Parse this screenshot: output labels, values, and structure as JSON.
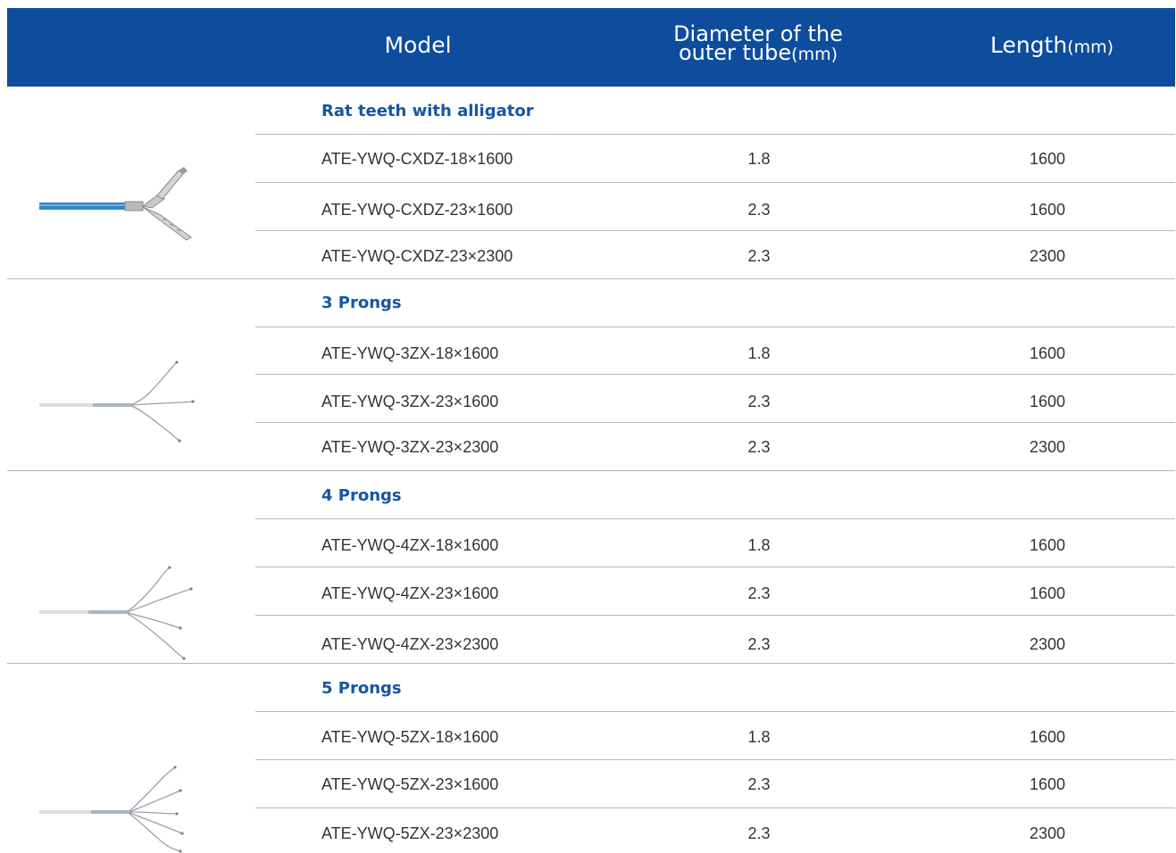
{
  "header": {
    "model": "Model",
    "diameter_line1": "Diameter of the",
    "diameter_line2": "outer tube",
    "diameter_unit": "(mm)",
    "length": "Length",
    "length_unit": "(mm)"
  },
  "colors": {
    "header_bg": "#0e4c9e",
    "group_title": "#1556a5",
    "tube_blue": "#2b86c9"
  },
  "groups": [
    {
      "title": "Rat teeth with alligator",
      "icon": "rat-tooth-alligator-forceps-icon",
      "rows": [
        {
          "model": "ATE-YWQ-CXDZ-18×1600",
          "diameter": "1.8",
          "length": "1600"
        },
        {
          "model": "ATE-YWQ-CXDZ-23×1600",
          "diameter": "2.3",
          "length": "1600"
        },
        {
          "model": "ATE-YWQ-CXDZ-23×2300",
          "diameter": "2.3",
          "length": "2300"
        }
      ]
    },
    {
      "title": "3 Prongs",
      "icon": "three-prong-grasper-icon",
      "rows": [
        {
          "model": "ATE-YWQ-3ZX-18×1600",
          "diameter": "1.8",
          "length": "1600"
        },
        {
          "model": "ATE-YWQ-3ZX-23×1600",
          "diameter": "2.3",
          "length": "1600"
        },
        {
          "model": "ATE-YWQ-3ZX-23×2300",
          "diameter": "2.3",
          "length": "2300"
        }
      ]
    },
    {
      "title": "4 Prongs",
      "icon": "four-prong-grasper-icon",
      "rows": [
        {
          "model": "ATE-YWQ-4ZX-18×1600",
          "diameter": "1.8",
          "length": "1600"
        },
        {
          "model": "ATE-YWQ-4ZX-23×1600",
          "diameter": "2.3",
          "length": "1600"
        },
        {
          "model": "ATE-YWQ-4ZX-23×2300",
          "diameter": "2.3",
          "length": "2300"
        }
      ]
    },
    {
      "title": "5 Prongs",
      "icon": "five-prong-grasper-icon",
      "rows": [
        {
          "model": "ATE-YWQ-5ZX-18×1600",
          "diameter": "1.8",
          "length": "1600"
        },
        {
          "model": "ATE-YWQ-5ZX-23×1600",
          "diameter": "2.3",
          "length": "1600"
        },
        {
          "model": "ATE-YWQ-5ZX-23×2300",
          "diameter": "2.3",
          "length": "2300"
        }
      ]
    }
  ]
}
